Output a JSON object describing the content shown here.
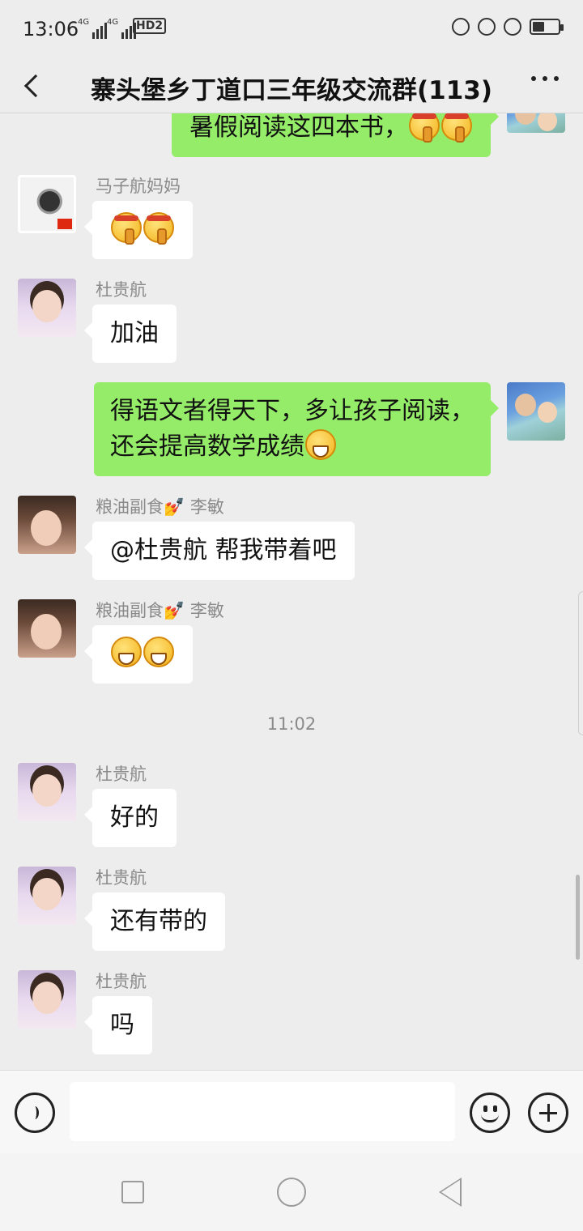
{
  "status_bar": {
    "time": "13:06",
    "network1": "4G",
    "network2": "4G",
    "hd": "HD2",
    "battery_level": 0.45
  },
  "header": {
    "title": "寨头堡乡丁道口三年级交流群(113)",
    "back_icon": "chevron-left-icon",
    "more_icon": "more-dots-icon"
  },
  "messages": [
    {
      "side": "right",
      "text": "暑假阅读这四本书，",
      "emoji": [
        "shush",
        "shush"
      ]
    },
    {
      "side": "left",
      "sender": "马子航妈妈",
      "text": "",
      "emoji": [
        "shush",
        "shush"
      ]
    },
    {
      "side": "left",
      "sender": "杜贵航",
      "text": "加油"
    },
    {
      "side": "right",
      "line1": "得语文者得天下，多让孩子阅读，",
      "line2": "还会提高数学成绩",
      "emoji": [
        "grin"
      ]
    },
    {
      "side": "left",
      "sender": "粮油副食💅 李敏",
      "text": "@杜贵航  帮我带着吧"
    },
    {
      "side": "left",
      "sender": "粮油副食💅 李敏",
      "text": "",
      "emoji": [
        "grin",
        "grin"
      ]
    },
    {
      "side": "left",
      "sender": "杜贵航",
      "text": "好的"
    },
    {
      "side": "left",
      "sender": "杜贵航",
      "text": "还有带的"
    },
    {
      "side": "left",
      "sender": "杜贵航",
      "text": "吗"
    }
  ],
  "timestamp": "11:02",
  "input_bar": {
    "voice_icon": "voice-icon",
    "emoji_icon": "emoji-icon",
    "plus_icon": "plus-icon",
    "text_value": ""
  },
  "nav_bar": {
    "recent_icon": "square-icon",
    "home_icon": "circle-icon",
    "back_icon": "triangle-back-icon"
  }
}
